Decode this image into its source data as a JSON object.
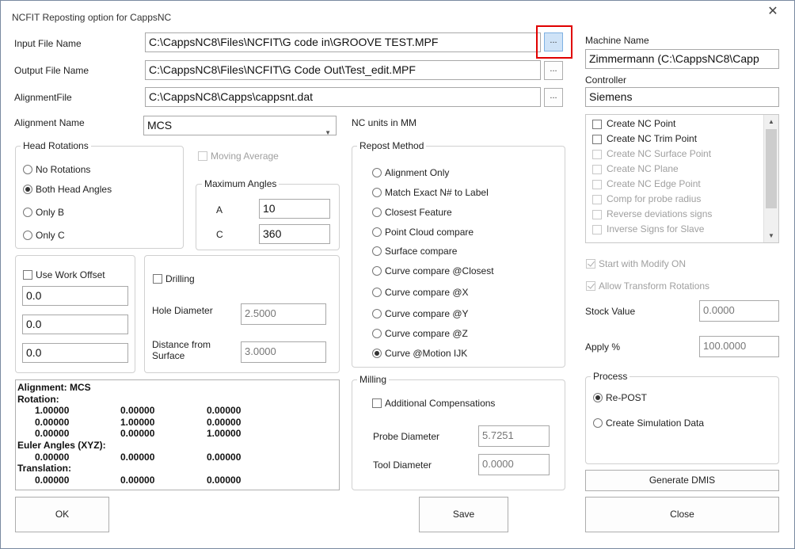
{
  "window": {
    "title": "NCFIT Reposting option for CappsNC",
    "close_glyph": "✕"
  },
  "files": {
    "input_label": "Input File Name",
    "input_value": "C:\\CappsNC8\\Files\\NCFIT\\G code in\\GROOVE TEST.MPF",
    "output_label": "Output File Name",
    "output_value": "C:\\CappsNC8\\Files\\NCFIT\\G Code Out\\Test_edit.MPF",
    "alignment_label": "AlignmentFile",
    "alignment_value": "C:\\CappsNC8\\Capps\\cappsnt.dat",
    "browse_label": "..."
  },
  "alignment_name": {
    "label": "Alignment Name",
    "value": "MCS"
  },
  "nc_units": "NC units in MM",
  "head_rotations": {
    "title": "Head Rotations",
    "options": [
      {
        "label": "No Rotations",
        "selected": false
      },
      {
        "label": "Both Head Angles",
        "selected": true
      },
      {
        "label": "Only B",
        "selected": false
      },
      {
        "label": "Only C",
        "selected": false
      }
    ]
  },
  "moving_average": {
    "label": "Moving Average",
    "checked": false,
    "enabled": false
  },
  "max_angles": {
    "title": "Maximum  Angles",
    "a_label": "A",
    "a_value": "10",
    "c_label": "C",
    "c_value": "360"
  },
  "work_offset": {
    "label": "Use Work Offset",
    "checked": false,
    "values": [
      "0.0",
      "0.0",
      "0.0"
    ]
  },
  "drilling": {
    "label": "Drilling",
    "checked": false,
    "hole_diameter_label": "Hole Diameter",
    "hole_diameter_value": "2.5000",
    "distance_label_1": "Distance from",
    "distance_label_2": "Surface",
    "distance_value": "3.0000"
  },
  "repost_method": {
    "title": "Repost Method",
    "options": [
      {
        "label": "Alignment Only",
        "selected": false
      },
      {
        "label": "Match Exact N# to Label",
        "selected": false
      },
      {
        "label": "Closest Feature",
        "selected": false
      },
      {
        "label": "Point Cloud compare",
        "selected": false
      },
      {
        "label": "Surface compare",
        "selected": false
      },
      {
        "label": "Curve compare @Closest",
        "selected": false
      },
      {
        "label": "Curve compare @X",
        "selected": false
      },
      {
        "label": "Curve compare @Y",
        "selected": false
      },
      {
        "label": "Curve compare @Z",
        "selected": false
      },
      {
        "label": "Curve @Motion IJK",
        "selected": true
      }
    ]
  },
  "milling": {
    "title": "Milling",
    "additional_label": "Additional Compensations",
    "additional_checked": false,
    "probe_label": "Probe Diameter",
    "probe_value": "5.7251",
    "tool_label": "Tool Diameter",
    "tool_value": "0.0000"
  },
  "alignment_info": {
    "header": "Alignment: MCS",
    "rotation_label": "Rotation:",
    "rotation_rows": [
      [
        "1.00000",
        "0.00000",
        "0.00000"
      ],
      [
        "0.00000",
        "1.00000",
        "0.00000"
      ],
      [
        "0.00000",
        "0.00000",
        "1.00000"
      ]
    ],
    "euler_label": "Euler Angles (XYZ):",
    "euler_row": [
      "0.00000",
      "0.00000",
      "0.00000"
    ],
    "translation_label": "Translation:",
    "translation_row": [
      "0.00000",
      "0.00000",
      "0.00000"
    ]
  },
  "machine": {
    "label": "Machine Name",
    "value": "Zimmermann   (C:\\CappsNC8\\Capp"
  },
  "controller": {
    "label": "Controller",
    "value": "Siemens"
  },
  "nc_options": [
    {
      "label": "Create NC Point",
      "enabled": true,
      "checked": false
    },
    {
      "label": "Create NC Trim Point",
      "enabled": true,
      "checked": false
    },
    {
      "label": "Create NC Surface Point",
      "enabled": false,
      "checked": false
    },
    {
      "label": "Create NC Plane",
      "enabled": false,
      "checked": false
    },
    {
      "label": "Create NC Edge Point",
      "enabled": false,
      "checked": false
    },
    {
      "label": "Comp for probe radius",
      "enabled": false,
      "checked": false
    },
    {
      "label": "Reverse deviations signs",
      "enabled": false,
      "checked": false
    },
    {
      "label": "Inverse Signs for Slave",
      "enabled": false,
      "checked": false
    }
  ],
  "start_modify": {
    "label": "Start with Modify ON",
    "checked": true,
    "enabled": false
  },
  "allow_transform": {
    "label": "Allow Transform Rotations",
    "checked": true,
    "enabled": false
  },
  "stock": {
    "label": "Stock Value",
    "value": "0.0000"
  },
  "apply": {
    "label": "Apply  %",
    "value": "100.0000"
  },
  "process": {
    "title": "Process",
    "options": [
      {
        "label": "Re-POST",
        "selected": true
      },
      {
        "label": "Create Simulation Data",
        "selected": false
      }
    ]
  },
  "buttons": {
    "ok": "OK",
    "save": "Save",
    "generate_dmis": "Generate DMIS",
    "close": "Close"
  }
}
